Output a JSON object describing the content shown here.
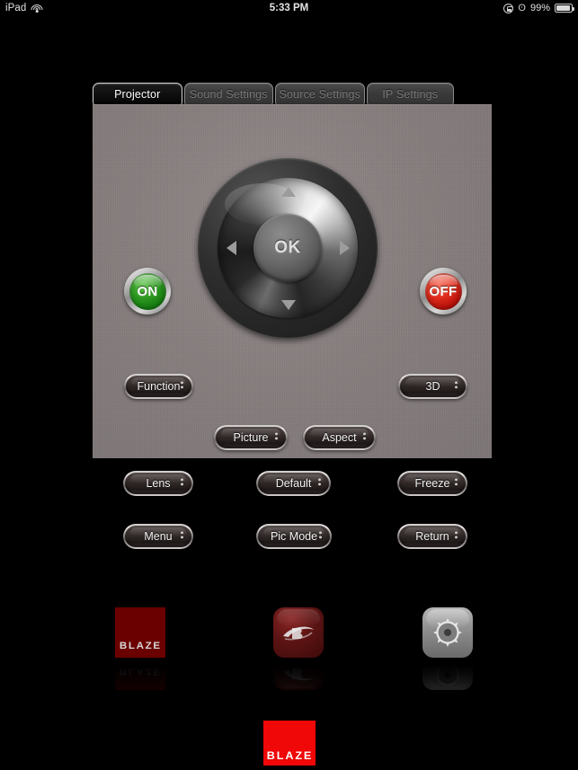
{
  "status_bar": {
    "device": "iPad",
    "wifi_icon": "wifi-icon",
    "time": "5:33 PM",
    "rotation_lock_icon": "rotation-lock-icon",
    "bluetooth_icon": "bluetooth-icon",
    "bluetooth_glyph": "ʘ",
    "battery_percent": "99%",
    "battery_icon": "battery-icon",
    "charging_glyph": "⚡"
  },
  "tabs": [
    {
      "label": "Projector",
      "active": true
    },
    {
      "label": "Sound Settings",
      "active": false
    },
    {
      "label": "Source Settings",
      "active": false
    },
    {
      "label": "IP Settings",
      "active": false
    }
  ],
  "remote": {
    "power": {
      "on_label": "ON",
      "off_label": "OFF",
      "on_color": "#2f9a22",
      "off_color": "#e02d1c"
    },
    "dpad": {
      "ok_label": "OK",
      "up_icon": "arrow-up-icon",
      "down_icon": "arrow-down-icon",
      "left_icon": "arrow-left-icon",
      "right_icon": "arrow-right-icon"
    },
    "buttons": {
      "function": "Function",
      "three_d": "3D",
      "picture": "Picture",
      "aspect": "Aspect",
      "lens": "Lens",
      "default": "Default",
      "freeze": "Freeze",
      "menu": "Menu",
      "pic_mode": "Pic Mode",
      "return": "Return"
    }
  },
  "home_icons": [
    {
      "label": "BLAZE",
      "name": "blaze-app-icon"
    },
    {
      "label": "",
      "name": "bluray-app-icon"
    },
    {
      "label": "",
      "name": "settings-app-icon"
    }
  ],
  "dock": {
    "blaze_label": "BLAZE",
    "brand_color": "#f00707"
  }
}
